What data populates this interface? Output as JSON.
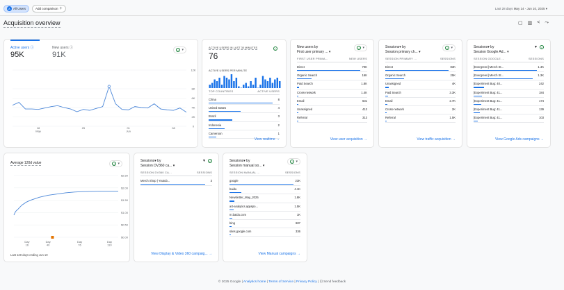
{
  "topbar": {
    "segment_badge": "A",
    "segment": "All Users",
    "add_comparison": "Add comparison",
    "add_icon": "plus-icon",
    "date_range_label": "Last 28 days",
    "date_range": "May 14 - Jun 10, 2025"
  },
  "page": {
    "title": "Acquisition overview",
    "actions": [
      "customize-report-icon",
      "compare-icon",
      "share-icon",
      "insights-icon"
    ]
  },
  "colors": {
    "accent": "#1a73e8",
    "ok": "#188038",
    "marker": "#e37400"
  },
  "overview": {
    "tabs": [
      {
        "label": "Active users",
        "value": "95K"
      },
      {
        "label": "New users",
        "value": "91K"
      }
    ],
    "chart_data": {
      "type": "line",
      "x": [
        "May 14",
        "May 15",
        "May 16",
        "May 17",
        "May 18",
        "May 19",
        "May 20",
        "May 21",
        "May 22",
        "May 23",
        "May 24",
        "May 25",
        "May 26",
        "May 27",
        "May 28",
        "May 29",
        "May 30",
        "May 31",
        "Jun 01",
        "Jun 02",
        "Jun 03",
        "Jun 04",
        "Jun 05",
        "Jun 06",
        "Jun 07",
        "Jun 08",
        "Jun 09",
        "Jun 10"
      ],
      "values": [
        4500,
        5100,
        3700,
        3700,
        3600,
        3900,
        4200,
        4400,
        4000,
        3700,
        3100,
        3600,
        3400,
        3800,
        4200,
        8500,
        4800,
        3600,
        3500,
        4200,
        4000,
        3900,
        4800,
        3700,
        3500,
        3400,
        3900,
        3000
      ],
      "ylim": [
        0,
        12000
      ],
      "yticks": [
        "12K",
        "8K",
        "6K",
        "4K",
        "2K",
        "0"
      ],
      "xticks": [
        {
          "d": "18",
          "m": "May"
        },
        {
          "d": "25",
          "m": ""
        },
        {
          "d": "01",
          "m": "Jun"
        },
        {
          "d": "08",
          "m": ""
        }
      ],
      "grid": true
    }
  },
  "realtime": {
    "title": "ACTIVE USERS IN LAST 30 MINUTES",
    "value": "76",
    "per_minute_label": "ACTIVE USERS PER MINUTE",
    "per_minute": [
      2,
      3,
      5,
      4,
      6,
      2,
      7,
      6,
      5,
      8,
      4,
      6,
      1,
      0,
      2,
      3,
      1,
      4,
      2,
      6,
      0,
      2,
      7,
      5,
      4,
      6,
      3,
      5,
      6,
      4
    ],
    "col1": "TOP COUNTRIES",
    "col2": "ACTIVE USERS",
    "rows": [
      {
        "name": "China",
        "value": "8",
        "pct": 100
      },
      {
        "name": "United States",
        "value": "4",
        "pct": 50
      },
      {
        "name": "Brazil",
        "value": "3",
        "pct": 37
      },
      {
        "name": "Indonesia",
        "value": "2",
        "pct": 25
      },
      {
        "name": "Cameroon",
        "value": "1",
        "pct": 12
      }
    ],
    "link": "View realtime"
  },
  "cards": [
    {
      "title1": "New users by",
      "title2": "First user primary ...",
      "col1": "FIRST USER PRIMA...",
      "col2": "NEW USERS",
      "filter": false,
      "rows": [
        {
          "name": "Direct",
          "value": "70K",
          "pct": 100
        },
        {
          "name": "Organic Search",
          "value": "16K",
          "pct": 23
        },
        {
          "name": "Paid Search",
          "value": "1.8K",
          "pct": 3
        },
        {
          "name": "Cross-network",
          "value": "1.4K",
          "pct": 2
        },
        {
          "name": "Email",
          "value": "631",
          "pct": 1
        },
        {
          "name": "Unassigned",
          "value": "413",
          "pct": 0.6
        },
        {
          "name": "Referral",
          "value": "313",
          "pct": 0.5
        }
      ],
      "link": "View user acquisition"
    },
    {
      "title1": "Sessions▾ by",
      "title2": "Session primary ch...",
      "col1": "SESSION PRIMARY ...",
      "col2": "SESSIONS",
      "filter": false,
      "rows": [
        {
          "name": "Direct",
          "value": "83K",
          "pct": 100
        },
        {
          "name": "Organic Search",
          "value": "25K",
          "pct": 30
        },
        {
          "name": "Unassigned",
          "value": "4K",
          "pct": 5
        },
        {
          "name": "Paid Search",
          "value": "3.3K",
          "pct": 4
        },
        {
          "name": "Email",
          "value": "2.7K",
          "pct": 3
        },
        {
          "name": "Cross-network",
          "value": "2K",
          "pct": 2.5
        },
        {
          "name": "Referral",
          "value": "1.5K",
          "pct": 2
        }
      ],
      "link": "View traffic acquisition"
    },
    {
      "title1": "Sessions▾ by",
      "title2": "Session Google Ad...",
      "col1": "SESSION GOOGLE ...",
      "col2": "SESSIONS",
      "filter": true,
      "rows": [
        {
          "name": "[Evergreen] Merch St...",
          "value": "1.4K",
          "pct": 100
        },
        {
          "name": "[Evergreen] Merch St...",
          "value": "1.3K",
          "pct": 93
        },
        {
          "name": "[Experiment Bug: 40...",
          "value": "242",
          "pct": 17
        },
        {
          "name": "[Experiment Bug: 41...",
          "value": "184",
          "pct": 13
        },
        {
          "name": "[Experiment Bug: 41...",
          "value": "174",
          "pct": 12
        },
        {
          "name": "[Experiment Bug: 41...",
          "value": "139",
          "pct": 10
        },
        {
          "name": "[Experiment Bug: 41...",
          "value": "103",
          "pct": 7
        }
      ],
      "link": "View Google Ads campaigns"
    },
    {
      "title1": "Sessions▾ by",
      "title2": "Session DV360 ca...",
      "col1": "SESSION DV360 CA...",
      "col2": "SESSIONS",
      "filter": true,
      "rows": [
        {
          "name": "Merch Shop | Youtub...",
          "value": "3",
          "pct": 100
        }
      ],
      "link": "View Display & Video 360 campaig..."
    },
    {
      "title1": "Sessions▾ by",
      "title2": "Session manual so...",
      "col1": "SESSION MANUAL ...",
      "col2": "SESSIONS",
      "filter": false,
      "rows": [
        {
          "name": "google",
          "value": "23K",
          "pct": 100
        },
        {
          "name": "baidu",
          "value": "4.1K",
          "pct": 18
        },
        {
          "name": "Newsletter_May_2025",
          "value": "1.8K",
          "pct": 8
        },
        {
          "name": "art-analytics.appspo...",
          "value": "1.5K",
          "pct": 6.5
        },
        {
          "name": "m.baidu.com",
          "value": "1K",
          "pct": 4.5
        },
        {
          "name": "bing",
          "value": "687",
          "pct": 3
        },
        {
          "name": "sites.google.com",
          "value": "336",
          "pct": 1.5
        }
      ],
      "link": "View Manual campaigns"
    }
  ],
  "ltv": {
    "title": "Average 120d value",
    "footnote": "Last 120 days ending Jun 10",
    "chart_data": {
      "type": "line",
      "x": [
        1,
        3,
        6,
        10,
        15,
        20,
        30,
        40,
        50,
        60,
        70,
        80,
        90,
        100,
        110,
        120
      ],
      "values": [
        0.9,
        1.05,
        1.15,
        1.3,
        1.42,
        1.5,
        1.62,
        1.7,
        1.75,
        1.8,
        1.83,
        1.85,
        1.86,
        1.87,
        1.87,
        1.87
      ],
      "ylim": [
        0,
        2.5
      ],
      "yticks": [
        "$2.50",
        "$2.00",
        "$1.50",
        "$1.00",
        "$0.50",
        "$0.00"
      ],
      "xticks": [
        {
          "l": "Day",
          "n": "16",
          "x": 16
        },
        {
          "l": "Day",
          "n": "40",
          "x": 40
        },
        {
          "l": "Day",
          "n": "76",
          "x": 76
        },
        {
          "l": "Day",
          "n": "110",
          "x": 110
        }
      ],
      "marker_day": 45,
      "grid": true
    }
  },
  "footer": {
    "copyright": "© 2025 Google |",
    "home": "Analytics home",
    "sep1": "|",
    "tos": "Terms of Service",
    "sep2": "|",
    "privacy": "Privacy Policy",
    "sep3": "|",
    "feedback": "Send feedback"
  }
}
